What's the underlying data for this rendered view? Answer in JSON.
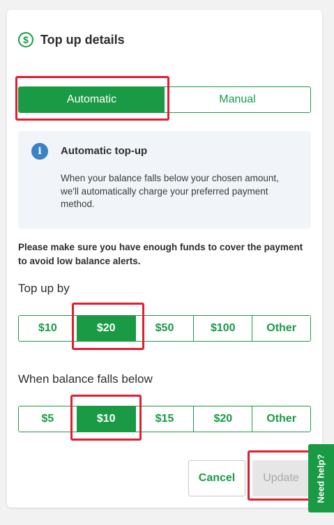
{
  "header": {
    "title": "Top up details",
    "icon": "dollar-circle-icon"
  },
  "mode": {
    "automatic": "Automatic",
    "manual": "Manual",
    "selected": "Automatic"
  },
  "info": {
    "title": "Automatic top-up",
    "body": "When your balance falls below your chosen amount, we'll automatically charge your preferred payment method."
  },
  "notice": "Please make sure you have enough funds to cover the payment to avoid low balance alerts.",
  "top_up": {
    "label": "Top up by",
    "options": [
      "$10",
      "$20",
      "$50",
      "$100",
      "Other"
    ],
    "selected": "$20"
  },
  "threshold": {
    "label": "When balance falls below",
    "options": [
      "$5",
      "$10",
      "$15",
      "$20",
      "Other"
    ],
    "selected": "$10"
  },
  "actions": {
    "cancel": "Cancel",
    "update": "Update"
  },
  "help": {
    "label": "Need help?"
  },
  "colors": {
    "accent": "#1a9a45",
    "info": "#3b82c4",
    "highlight": "#e01e2e"
  }
}
